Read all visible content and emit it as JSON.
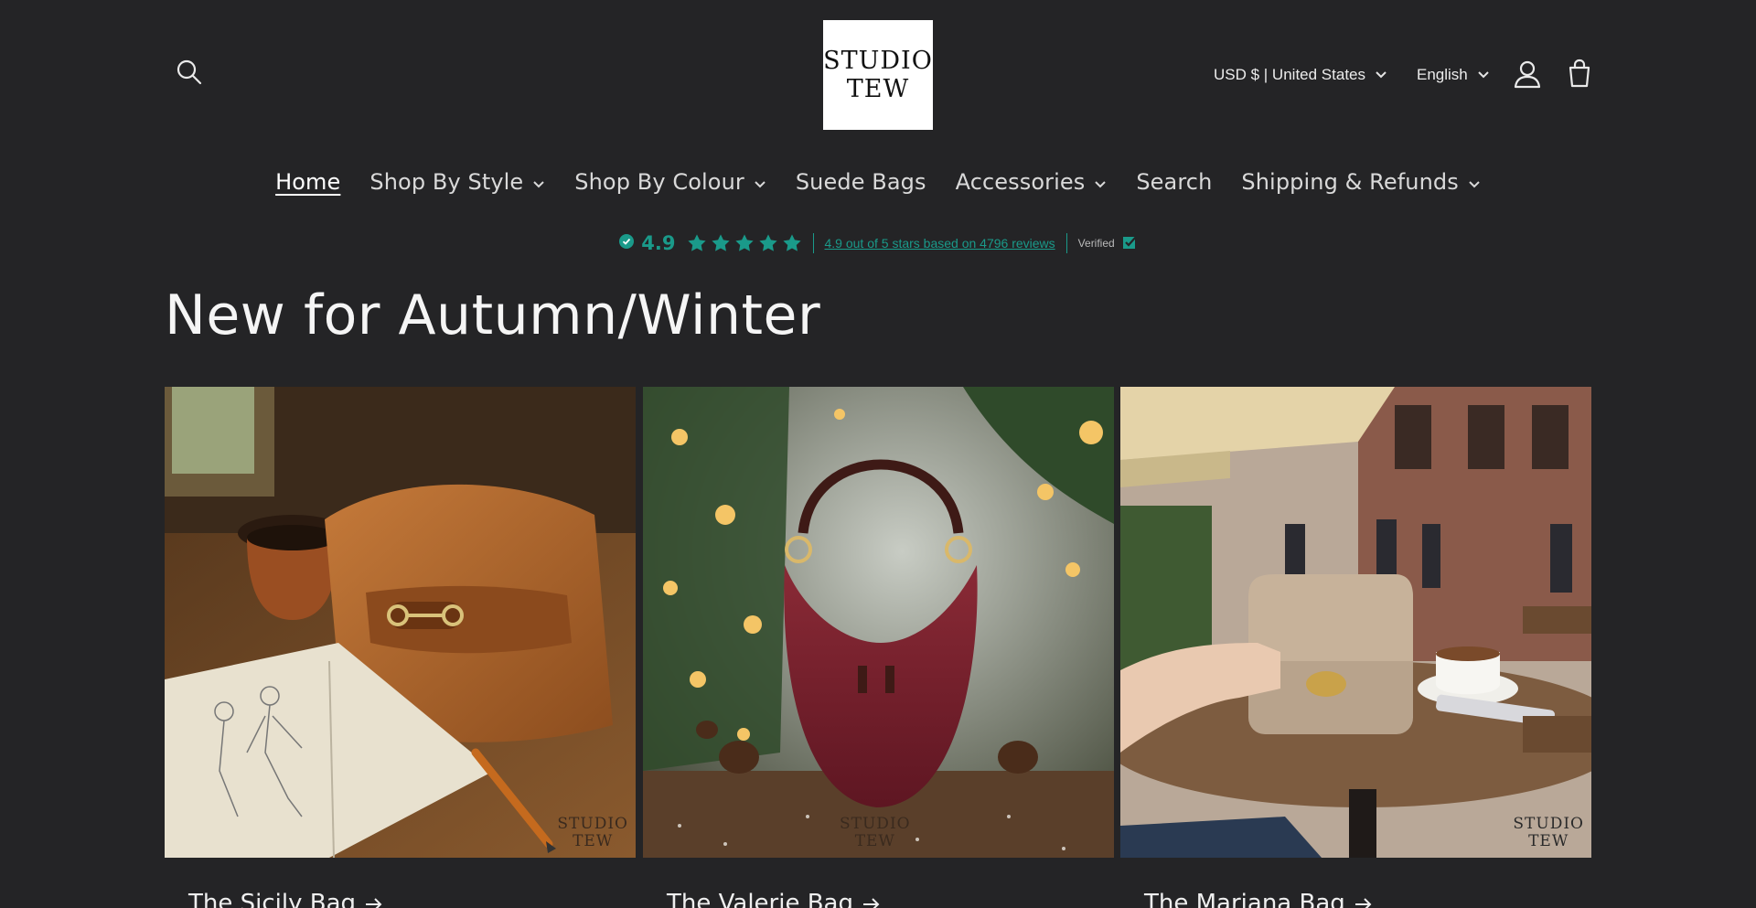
{
  "header": {
    "logo_line1": "STUDIO",
    "logo_line2": "TEW",
    "currency_label": "USD $ | United States",
    "language_label": "English",
    "icons": {
      "search": "search-icon",
      "account": "account-icon",
      "cart": "cart-icon"
    }
  },
  "nav": {
    "items": [
      {
        "label": "Home",
        "active": true,
        "has_dropdown": false
      },
      {
        "label": "Shop By Style",
        "active": false,
        "has_dropdown": true
      },
      {
        "label": "Shop By Colour",
        "active": false,
        "has_dropdown": true
      },
      {
        "label": "Suede Bags",
        "active": false,
        "has_dropdown": false
      },
      {
        "label": "Accessories",
        "active": false,
        "has_dropdown": true
      },
      {
        "label": "Search",
        "active": false,
        "has_dropdown": false
      },
      {
        "label": "Shipping & Refunds",
        "active": false,
        "has_dropdown": true
      }
    ]
  },
  "reviews": {
    "rating": "4.9",
    "stars": 5,
    "summary": "4.9 out of 5 stars based on 4796 reviews",
    "verified_label": "Verified",
    "accent_color": "#1a9a8a"
  },
  "section": {
    "title": "New for Autumn/Winter"
  },
  "products": [
    {
      "name": "The Sicily Bag",
      "watermark_line1": "STUDIO",
      "watermark_line2": "TEW"
    },
    {
      "name": "The Valerie Bag",
      "watermark_line1": "STUDIO",
      "watermark_line2": "TEW"
    },
    {
      "name": "The Mariana Bag",
      "watermark_line1": "STUDIO",
      "watermark_line2": "TEW"
    }
  ]
}
